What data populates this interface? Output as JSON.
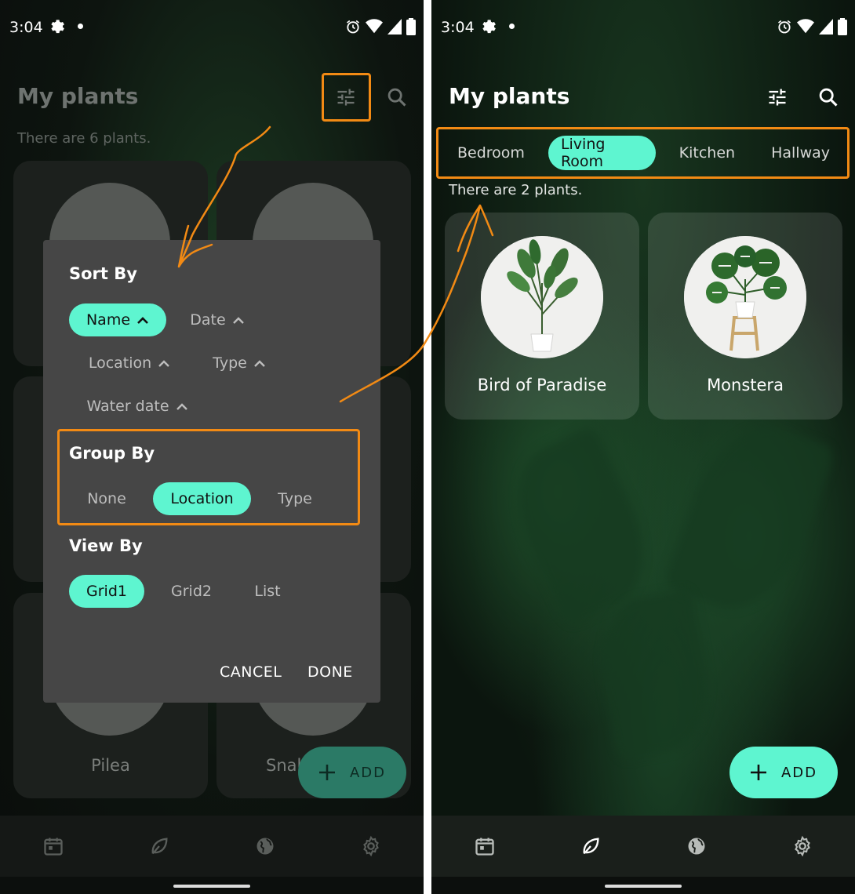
{
  "status": {
    "time": "3:04"
  },
  "left": {
    "title": "My plants",
    "count_text": "There are 6 plants.",
    "cards": [
      {
        "name": ""
      },
      {
        "name": ""
      },
      {
        "name": "Pilea"
      },
      {
        "name": "Snal"
      }
    ],
    "fab_label": "ADD",
    "dialog": {
      "sort_heading": "Sort By",
      "sort_options": [
        "Name",
        "Date",
        "Location",
        "Type",
        "Water date"
      ],
      "sort_selected": "Name",
      "group_heading": "Group By",
      "group_options": [
        "None",
        "Location",
        "Type"
      ],
      "group_selected": "Location",
      "view_heading": "View By",
      "view_options": [
        "Grid1",
        "Grid2",
        "List"
      ],
      "view_selected": "Grid1",
      "cancel_label": "CANCEL",
      "done_label": "DONE"
    }
  },
  "right": {
    "title": "My plants",
    "tabs": [
      "Bedroom",
      "Living Room",
      "Kitchen",
      "Hallway"
    ],
    "tab_selected": "Living Room",
    "count_text": "There are 2 plants.",
    "cards": [
      {
        "name": "Bird of Paradise"
      },
      {
        "name": "Monstera"
      }
    ],
    "fab_label": "ADD"
  },
  "nav_items": [
    "calendar-icon",
    "leaf-icon",
    "globe-icon",
    "gear-icon"
  ],
  "colors": {
    "accent": "#5ef5d0",
    "annotation": "#f28a14",
    "dialog_bg": "#464646"
  }
}
